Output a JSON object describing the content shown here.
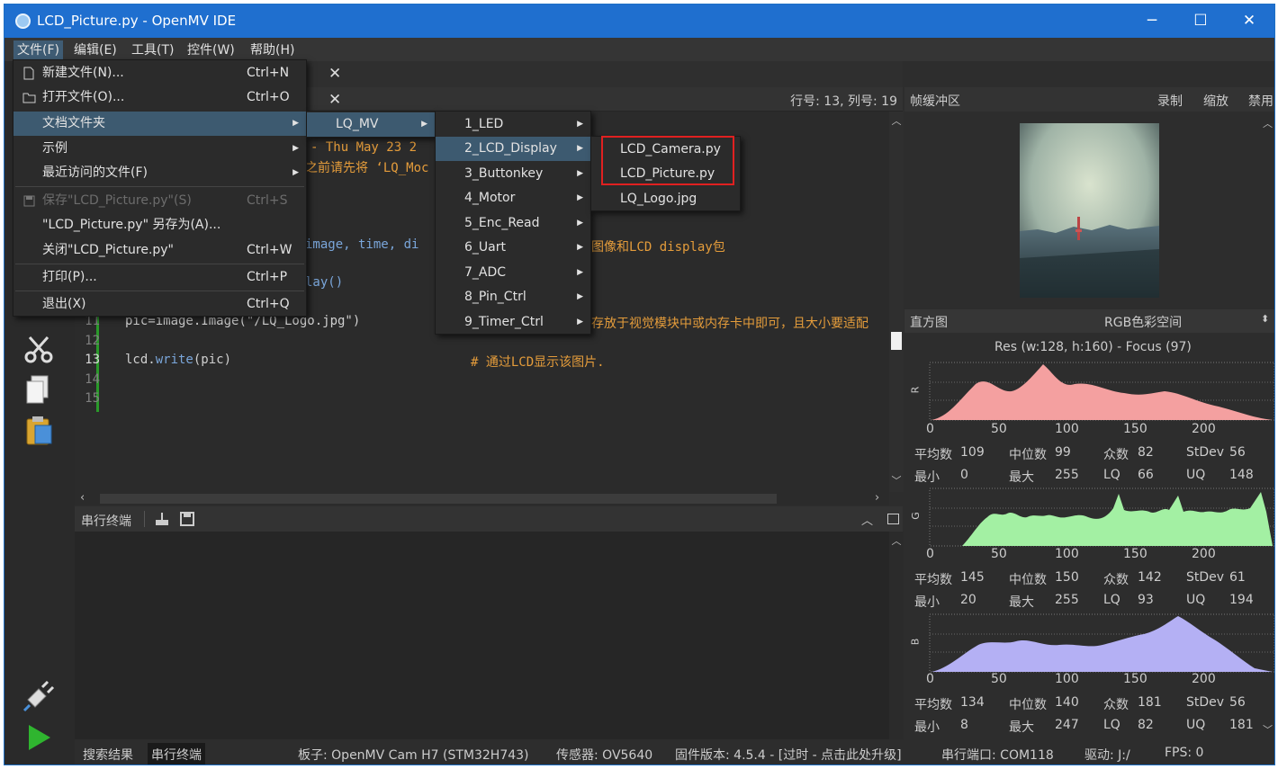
{
  "window": {
    "title": "LCD_Picture.py - OpenMV IDE",
    "minimize": "─",
    "maximize": "☐",
    "close": "✕"
  },
  "menubar": [
    "文件(F)",
    "编辑(E)",
    "工具(T)",
    "控件(W)",
    "帮助(H)"
  ],
  "tab_close": "✕",
  "editor": {
    "cursor_pos": "行号: 13, 列号: 19",
    "line_numbers": [
      "11",
      "12",
      "13",
      "14",
      "15"
    ],
    "code": {
      "header_frag": "- Thu May 23 2",
      "comment_frag": "之前请先将 ‘LQ_Moc",
      "import_frag": "image, time, di",
      "import_comment": "图像和LCD display包",
      "init_frag": "lay()",
      "line11": "pic=image.Image(\"/LQ_Logo.jpg\")",
      "line11_comment": "存放于视觉模块中或内存卡中即可，且大小要适配",
      "line13_obj": "lcd.",
      "line13_fn": "write",
      "line13_args": "(pic)",
      "line13_comment": "# 通过LCD显示该图片."
    }
  },
  "serial": {
    "title": "串行终端"
  },
  "framebuffer": {
    "title": "帧缓冲区",
    "record": "录制",
    "zoom": "缩放",
    "disable": "禁用"
  },
  "histogram": {
    "title": "直方图",
    "colorspace": "RGB色彩空间",
    "resolution": "Res (w:128, h:160) - Focus (97)",
    "axis_ticks": [
      "0",
      "50",
      "100",
      "150",
      "200"
    ],
    "channels": [
      {
        "label": "R",
        "color": "#f4a0a0",
        "mean_label": "平均数",
        "mean": "109",
        "median_label": "中位数",
        "median": "99",
        "mode_label": "众数",
        "mode": "82",
        "std_label": "StDev",
        "std": "56",
        "min_label": "最小",
        "min": "0",
        "max_label": "最大",
        "max": "255",
        "lq_label": "LQ",
        "lq": "66",
        "uq_label": "UQ",
        "uq": "148"
      },
      {
        "label": "G",
        "color": "#a3f0a3",
        "mean_label": "平均数",
        "mean": "145",
        "median_label": "中位数",
        "median": "150",
        "mode_label": "众数",
        "mode": "142",
        "std_label": "StDev",
        "std": "61",
        "min_label": "最小",
        "min": "20",
        "max_label": "最大",
        "max": "255",
        "lq_label": "LQ",
        "lq": "93",
        "uq_label": "UQ",
        "uq": "194"
      },
      {
        "label": "B",
        "color": "#b4b0f4",
        "mean_label": "平均数",
        "mean": "134",
        "median_label": "中位数",
        "median": "140",
        "mode_label": "众数",
        "mode": "181",
        "std_label": "StDev",
        "std": "56",
        "min_label": "最小",
        "min": "8",
        "max_label": "最大",
        "max": "247",
        "lq_label": "LQ",
        "lq": "82",
        "uq_label": "UQ",
        "uq": "181"
      }
    ]
  },
  "file_menu": [
    {
      "label": "新建文件(N)...",
      "shortcut": "Ctrl+N"
    },
    {
      "label": "打开文件(O)...",
      "shortcut": "Ctrl+O"
    },
    {
      "label": "文档文件夹",
      "shortcut": ""
    },
    {
      "label": "示例",
      "shortcut": ""
    },
    {
      "label": "最近访问的文件(F)",
      "shortcut": ""
    },
    {
      "label": "保存\"LCD_Picture.py\"(S)",
      "shortcut": "Ctrl+S"
    },
    {
      "label": "\"LCD_Picture.py\" 另存为(A)...",
      "shortcut": ""
    },
    {
      "label": "关闭\"LCD_Picture.py\"",
      "shortcut": "Ctrl+W"
    },
    {
      "label": "打印(P)...",
      "shortcut": "Ctrl+P"
    },
    {
      "label": "退出(X)",
      "shortcut": "Ctrl+Q"
    }
  ],
  "doc_menu": [
    "LQ_MV"
  ],
  "lqmv_menu": [
    "1_LED",
    "2_LCD_Display",
    "3_Buttonkey",
    "4_Motor",
    "5_Enc_Read",
    "6_Uart",
    "7_ADC",
    "8_Pin_Ctrl",
    "9_Timer_Ctrl"
  ],
  "lcd_menu": [
    "LCD_Camera.py",
    "LCD_Picture.py",
    "LQ_Logo.jpg"
  ],
  "statusbar": {
    "search_results": "搜索结果",
    "serial_terminal": "串行终端",
    "board": "板子: OpenMV Cam H7 (STM32H743)",
    "sensor": "传感器: OV5640",
    "firmware": "固件版本: 4.5.4 - [过时 - 点击此处升级]",
    "port": "串行端口: COM118",
    "drive": "驱动: J:/",
    "fps": "FPS: 0"
  }
}
